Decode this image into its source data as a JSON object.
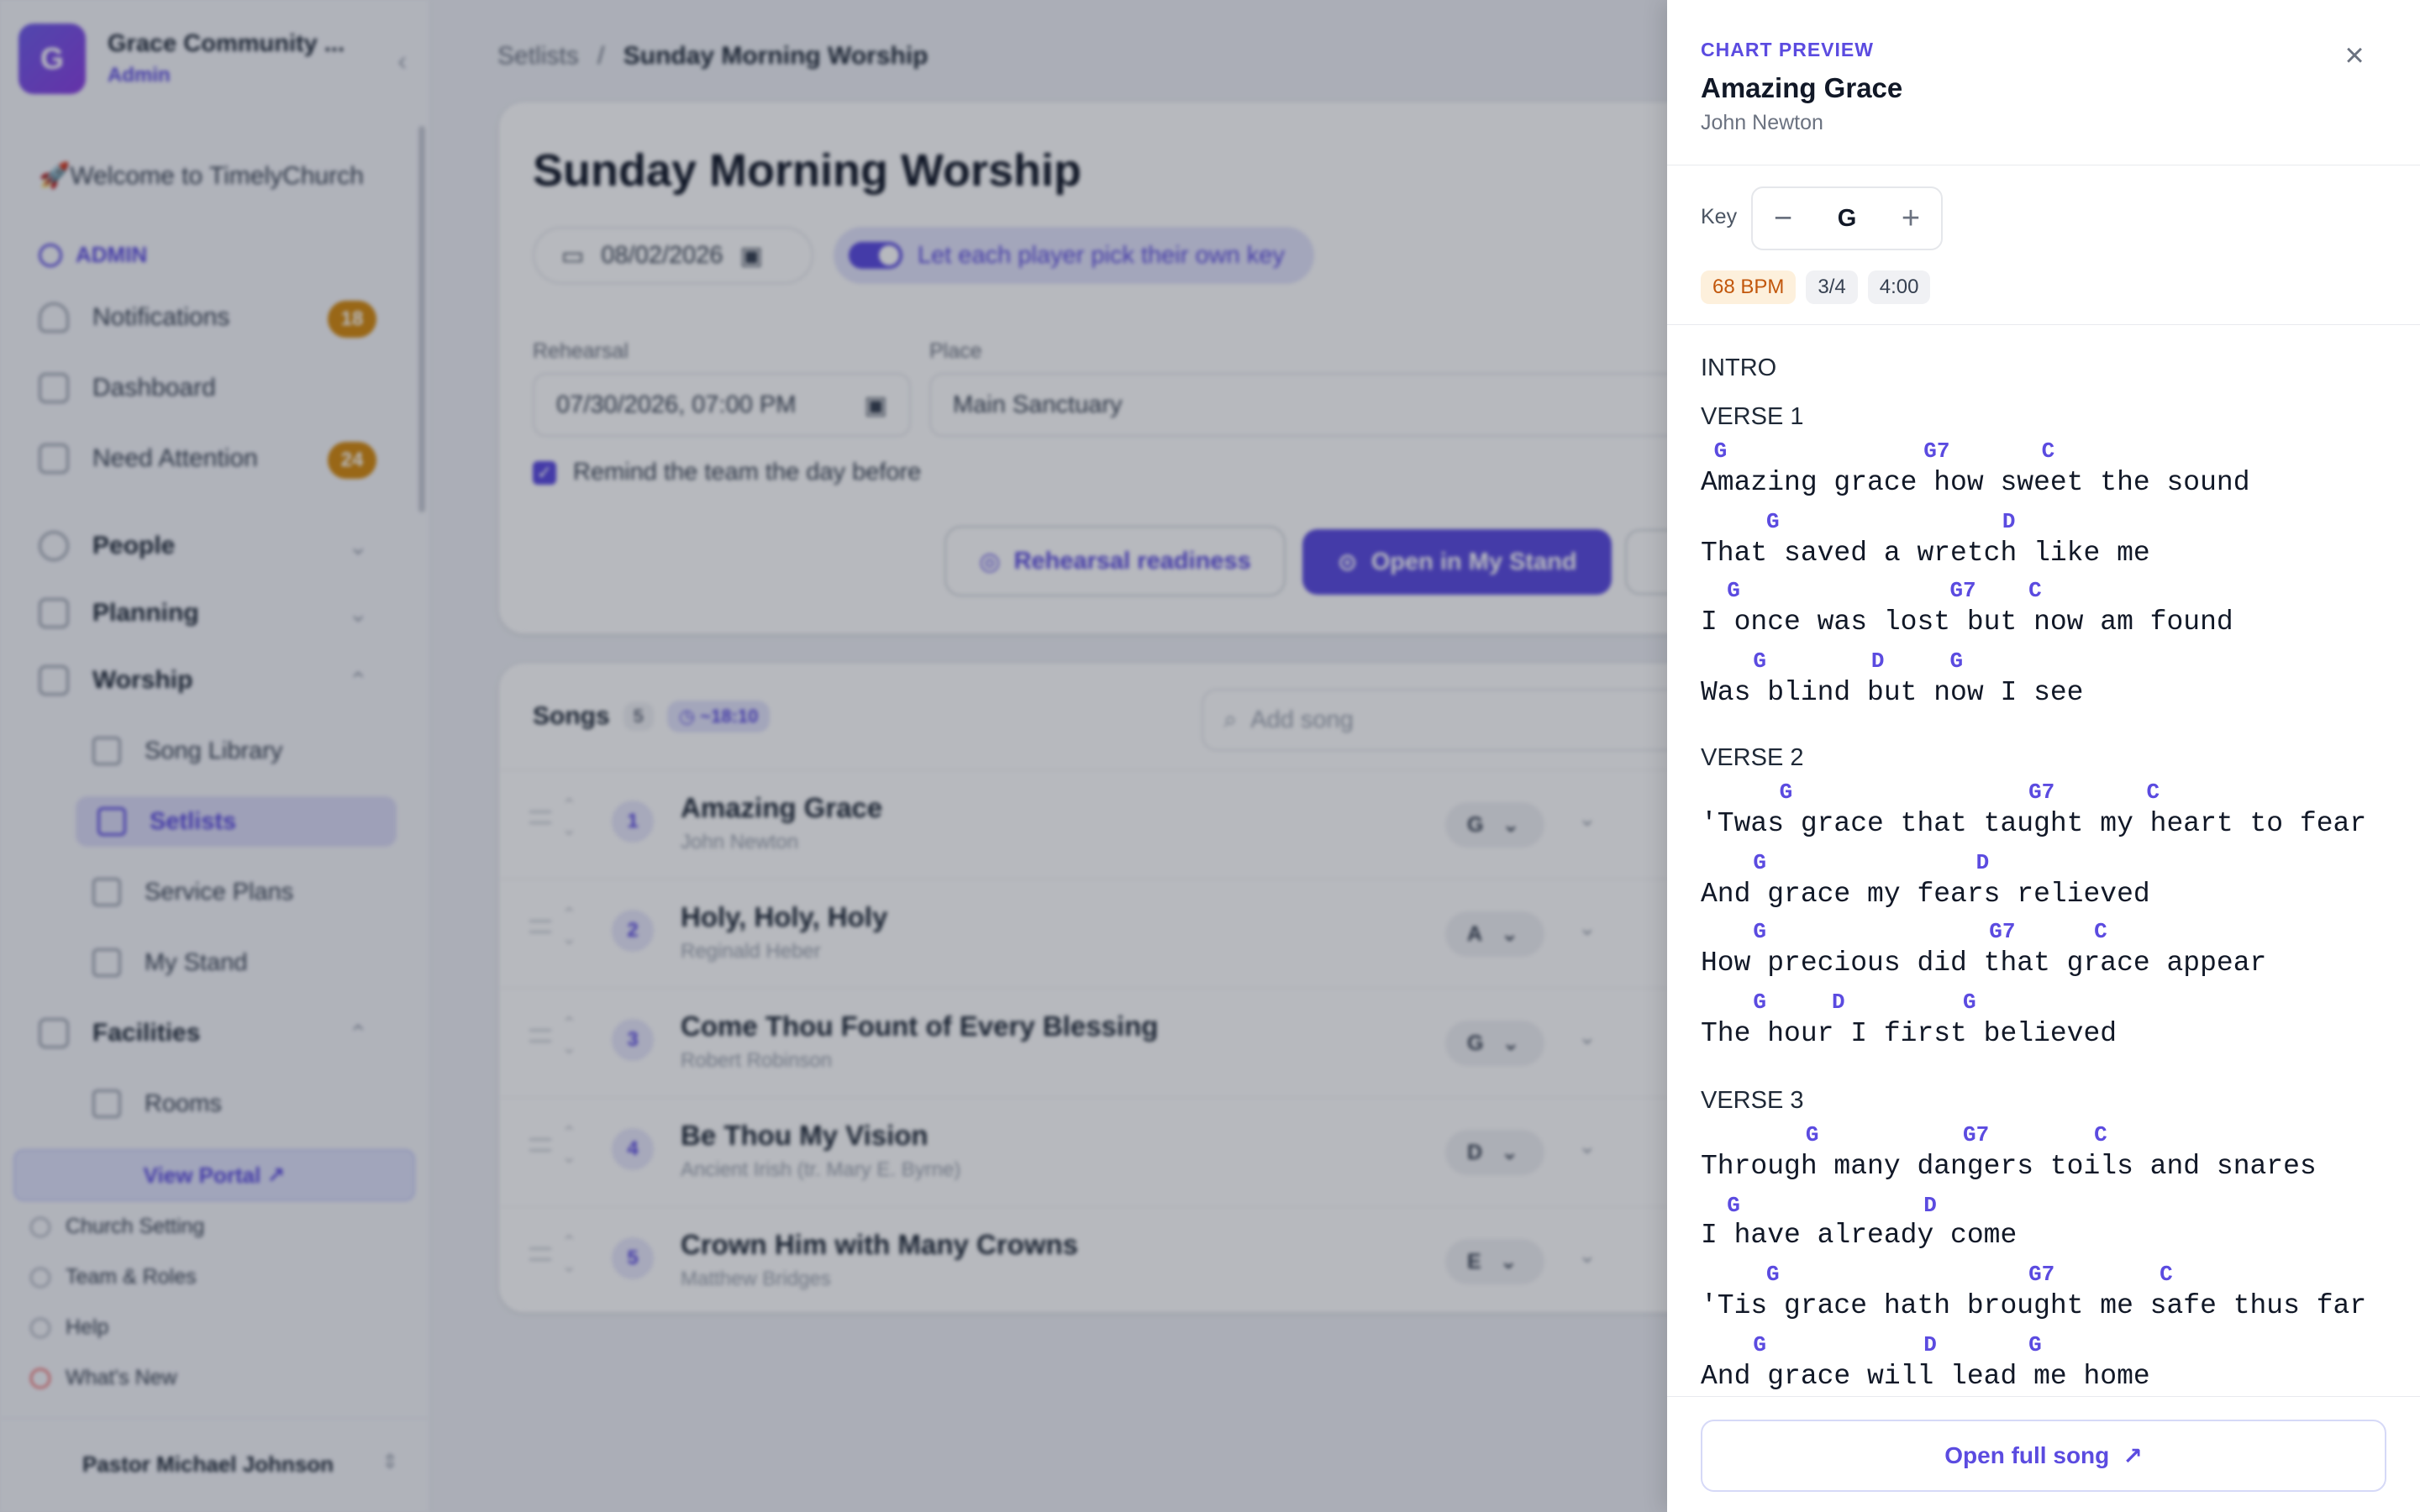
{
  "org": {
    "initial": "G",
    "name": "Grace Community ...",
    "role": "Admin"
  },
  "sidebar": {
    "welcome": "🚀Welcome to TimelyChurch",
    "admin_section": "ADMIN",
    "items": [
      {
        "label": "Notifications",
        "badge": "18"
      },
      {
        "label": "Dashboard"
      },
      {
        "label": "Need Attention",
        "badge": "24"
      },
      {
        "label": "People"
      },
      {
        "label": "Planning"
      },
      {
        "label": "Worship"
      },
      {
        "label": "Facilities"
      }
    ],
    "worship_sub": [
      "Song Library",
      "Setlists",
      "Service Plans",
      "My Stand"
    ],
    "facilities_sub": [
      "Rooms"
    ],
    "view_portal": "View Portal ↗",
    "footer": [
      "Church Setting",
      "Team & Roles",
      "Help",
      "What's New"
    ],
    "user": "Pastor Michael Johnson"
  },
  "breadcrumb": {
    "parent": "Setlists",
    "sep": "/",
    "current": "Sunday Morning Worship"
  },
  "setlist": {
    "title": "Sunday Morning Worship",
    "date": "08/02/2026",
    "toggle_label": "Let each player pick their own key",
    "rehearsal_label": "Rehearsal",
    "rehearsal_value": "07/30/2026, 07:00 PM",
    "place_label": "Place",
    "place_value": "Main Sanctuary",
    "remind_label": "Remind the team the day before",
    "readiness_btn": "Rehearsal readiness",
    "open_btn": "Open in My Stand"
  },
  "songs": {
    "header": "Songs",
    "count": "5",
    "duration": "~18:10",
    "add_placeholder": "Add song",
    "rows": [
      {
        "n": "1",
        "title": "Amazing Grace",
        "author": "John Newton",
        "key": "G"
      },
      {
        "n": "2",
        "title": "Holy, Holy, Holy",
        "author": "Reginald Heber",
        "key": "A"
      },
      {
        "n": "3",
        "title": "Come Thou Fount of Every Blessing",
        "author": "Robert Robinson",
        "key": "G"
      },
      {
        "n": "4",
        "title": "Be Thou My Vision",
        "author": "Ancient Irish (tr. Mary E. Byrne)",
        "key": "D"
      },
      {
        "n": "5",
        "title": "Crown Him with Many Crowns",
        "author": "Matthew Bridges",
        "key": "E"
      }
    ]
  },
  "panel": {
    "eyebrow": "CHART PREVIEW",
    "title": "Amazing Grace",
    "author": "John Newton",
    "key_label": "Key",
    "key_value": "G",
    "bpm": "68 BPM",
    "time_sig": "3/4",
    "length": "4:00",
    "open_full": "Open full song",
    "sections": [
      {
        "name": "INTRO",
        "lines": []
      },
      {
        "name": "VERSE 1",
        "lines": [
          {
            "chords": " G               G7       C",
            "lyric": "Amazing grace how sweet the sound"
          },
          {
            "chords": "     G                 D",
            "lyric": "That saved a wretch like me"
          },
          {
            "chords": "  G                G7    C",
            "lyric": "I once was lost but now am found"
          },
          {
            "chords": "    G        D     G",
            "lyric": "Was blind but now I see"
          }
        ]
      },
      {
        "name": "VERSE 2",
        "lines": [
          {
            "chords": "      G                  G7       C",
            "lyric": "'Twas grace that taught my heart to fear"
          },
          {
            "chords": "    G                D",
            "lyric": "And grace my fears relieved"
          },
          {
            "chords": "    G                 G7      C",
            "lyric": "How precious did that grace appear"
          },
          {
            "chords": "    G     D         G",
            "lyric": "The hour I first believed"
          }
        ]
      },
      {
        "name": "VERSE 3",
        "lines": [
          {
            "chords": "        G           G7        C",
            "lyric": "Through many dangers toils and snares"
          },
          {
            "chords": "  G              D",
            "lyric": "I have already come"
          },
          {
            "chords": "     G                   G7        C",
            "lyric": "'Tis grace hath brought me safe thus far"
          },
          {
            "chords": "    G            D       G",
            "lyric": "And grace will lead me home"
          }
        ]
      }
    ]
  },
  "colors": {
    "accent": "#5b4be0",
    "badge": "#d48a10",
    "bpm": "#c2570c"
  }
}
